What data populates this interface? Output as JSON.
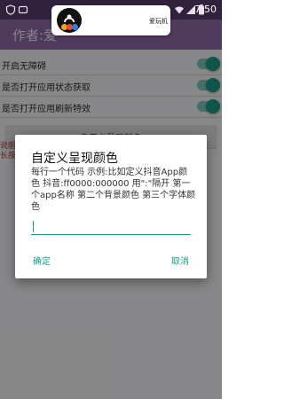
{
  "status_bar": {
    "time": "7:50"
  },
  "app_bar": {
    "title": "作者:爱"
  },
  "settings": [
    {
      "label": "开启无障碍"
    },
    {
      "label": "是否打开应用状态获取"
    },
    {
      "label": "是否打开应用刷新特效"
    }
  ],
  "custom_button": {
    "label": "自定义呈现颜色"
  },
  "hint_text": {
    "line1": "说明",
    "line2": "长按"
  },
  "notification": {
    "text": "爱玩机"
  },
  "dialog": {
    "title": "自定义呈现颜色",
    "message": "每行一个代码 示例:比如定义抖音App颜色 抖音:ff0000:000000 用\":\"隔开 第一个app名称 第二个背景颜色 第三个字体颜色",
    "input_value": "",
    "confirm_label": "确定",
    "cancel_label": "取消"
  },
  "colors": {
    "accent": "#1a9c8b",
    "app_bar": "#8e6aa8"
  }
}
